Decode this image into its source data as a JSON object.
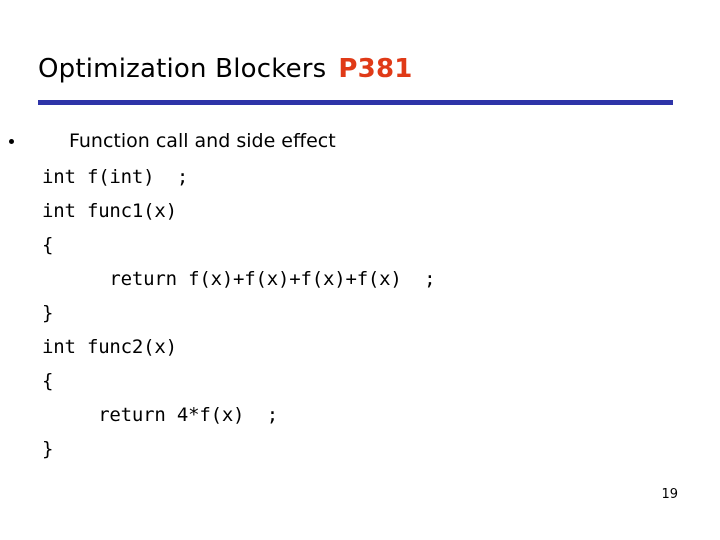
{
  "slide": {
    "title": {
      "main": "Optimization Blockers",
      "course": "P381",
      "course_color": "#E03A17",
      "rule_color": "#2E34A8"
    },
    "bullets": [
      {
        "marker": "bullet-dot",
        "text": "Function call and side effect"
      }
    ],
    "code_lines": [
      "int f(int)  ;",
      "int func1(x)",
      "{",
      "      return f(x)+f(x)+f(x)+f(x)  ;",
      "}",
      "int func2(x)",
      "{",
      "     return 4*f(x)  ;",
      "}"
    ],
    "page_number": "19"
  }
}
